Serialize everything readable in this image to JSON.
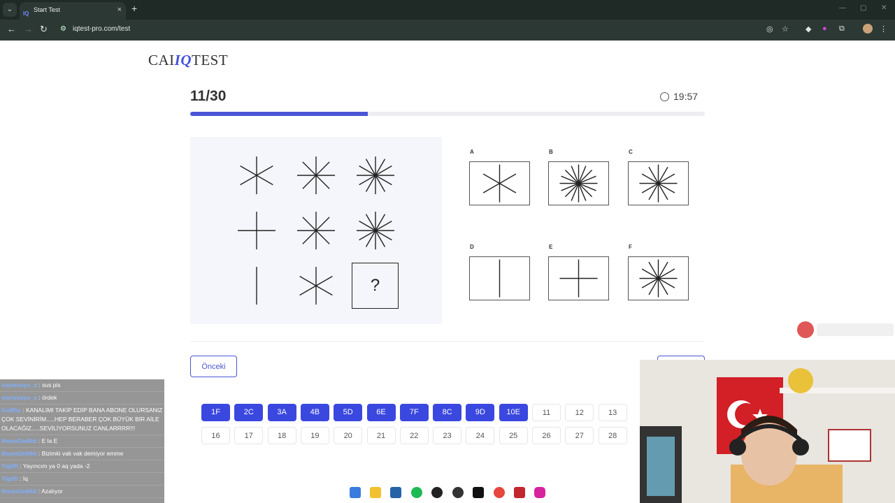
{
  "browser": {
    "tab_title": "Start Test",
    "tab_favicon": "IQ",
    "url": "iqtest-pro.com/test"
  },
  "site": {
    "logo_left": "CAI",
    "logo_mid": "IQ",
    "logo_right": "TEST"
  },
  "test": {
    "counter": "11/30",
    "timer": "19:57",
    "progress_fraction": 0.345
  },
  "puzzle": {
    "question_mark": "?"
  },
  "options": [
    {
      "label": "A",
      "shape": "star-6"
    },
    {
      "label": "B",
      "shape": "star-16"
    },
    {
      "label": "C",
      "shape": "star-12"
    },
    {
      "label": "D",
      "shape": "line-vertical"
    },
    {
      "label": "E",
      "shape": "cross"
    },
    {
      "label": "F",
      "shape": "star-12"
    }
  ],
  "buttons": {
    "prev_label": "Önceki"
  },
  "question_nav": {
    "row1": [
      "1F",
      "2C",
      "3A",
      "4B",
      "5D",
      "6E",
      "7F",
      "8C",
      "9D",
      "10E",
      "11",
      "12",
      "13"
    ],
    "row2": [
      "16",
      "17",
      "18",
      "19",
      "20",
      "21",
      "22",
      "23",
      "24",
      "25",
      "26",
      "27",
      "28"
    ],
    "answered_count": 10
  },
  "chat": [
    {
      "name": "vişnesuyu_a",
      "text": ": sus pis"
    },
    {
      "name": "vişnesuyu_a",
      "text": ": ördek"
    },
    {
      "name": "GotRix",
      "text": ": KANALIMI TAKİP EDİP BANA ABONE OLURSANIZ ÇOK SEVİNİRİM.....HEP BERABER ÇOK BÜYÜK BİR AİLE OLACAĞIZ.....SEVİLİYORSUNUZ CANLARRRR!!!"
    },
    {
      "name": "IhsanGedikk",
      "text": ": E la E"
    },
    {
      "name": "IhsanGedikk",
      "text": ": Bizimki vak vak demiyor emme"
    },
    {
      "name": "Yigitft",
      "text": ": Yayıncım ya 0 aq yada -2"
    },
    {
      "name": "Yigitft",
      "text": ": İq"
    },
    {
      "name": "IhsanGedikk",
      "text": ": Azalıyor"
    }
  ],
  "colors": {
    "accent": "#4a55d6",
    "answered": "#3a48e0"
  }
}
